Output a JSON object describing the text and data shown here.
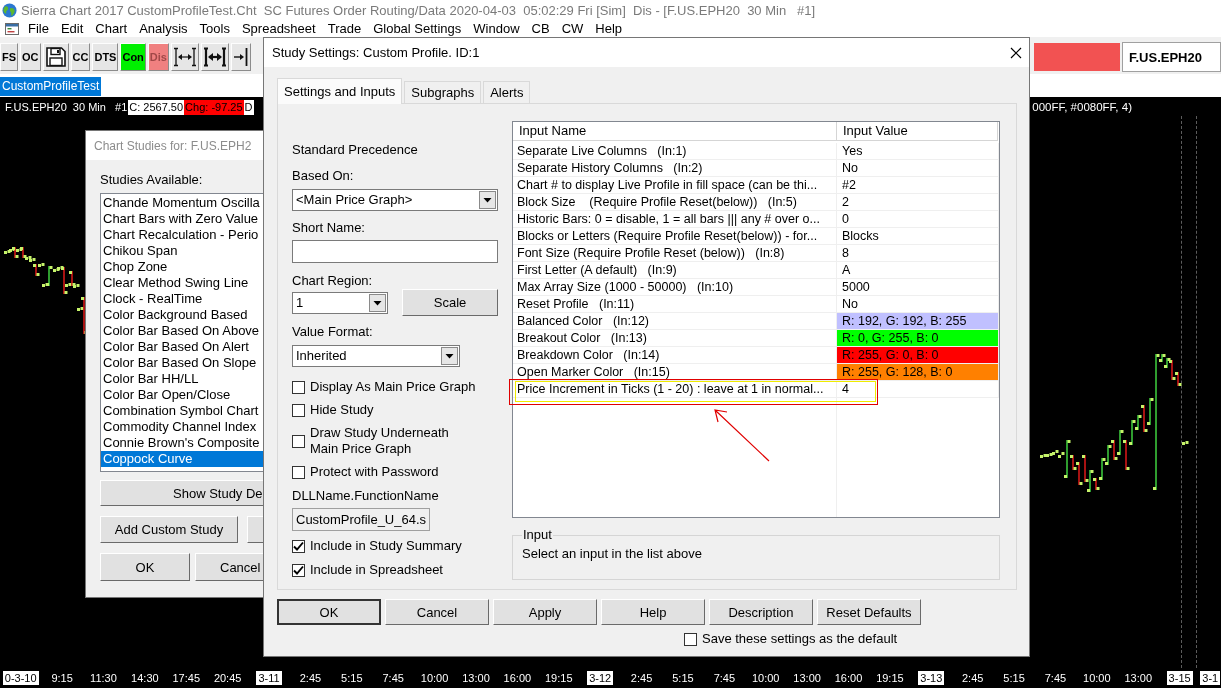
{
  "window": {
    "title": "Sierra Chart 2017 CustomProfileTest.Cht  SC Futures Order Routing/Data 2020-04-03  05:02:29 Fri [Sim]  Dis - [F.US.EPH20  30 Min   #1]"
  },
  "menu": [
    "File",
    "Edit",
    "Chart",
    "Analysis",
    "Tools",
    "Spreadsheet",
    "Trade",
    "Global Settings",
    "Window",
    "CB",
    "CW",
    "Help"
  ],
  "toolbar": {
    "buttons": [
      {
        "kind": "text",
        "label": "FS",
        "disabled": false
      },
      {
        "kind": "text",
        "label": "OC",
        "disabled": false
      },
      {
        "kind": "icon",
        "disabled": false
      },
      {
        "kind": "text",
        "label": "CC",
        "disabled": false
      },
      {
        "kind": "text",
        "label": "DTS",
        "disabled": false
      },
      {
        "kind": "text",
        "label": "Con",
        "disabled": false,
        "color": "#00f000"
      },
      {
        "kind": "text",
        "label": "Dis",
        "disabled": true,
        "color": "#f08080"
      },
      {
        "kind": "icon",
        "disabled": false
      },
      {
        "kind": "icon",
        "disabled": false
      },
      {
        "kind": "icon",
        "disabled": false
      }
    ],
    "symbol": "F.US.EPH20"
  },
  "chart_tabs": [
    {
      "label": "CustomProfileTest",
      "selected": true
    }
  ],
  "chart": {
    "info": [
      {
        "text": "F.US.EPH20  30 Min   #1",
        "color": "#000000"
      },
      {
        "text": "C: 2567.50",
        "color": "#ffffff"
      },
      {
        "text": "Chg: -97.25",
        "color": "#ff0000"
      },
      {
        "text": "D",
        "color": "#ffffff"
      }
    ],
    "info_right": "000FF, #0080FF, 4)",
    "time_axis": [
      {
        "kind": "date",
        "label": "0-3-10"
      },
      {
        "kind": "time",
        "label": "9:15"
      },
      {
        "kind": "time",
        "label": "11:30"
      },
      {
        "kind": "time",
        "label": "14:30"
      },
      {
        "kind": "time",
        "label": "17:45"
      },
      {
        "kind": "time",
        "label": "20:45"
      },
      {
        "kind": "date",
        "label": "3-11"
      },
      {
        "kind": "time",
        "label": "2:45"
      },
      {
        "kind": "time",
        "label": "5:15"
      },
      {
        "kind": "time",
        "label": "7:45"
      },
      {
        "kind": "time",
        "label": "10:00"
      },
      {
        "kind": "time",
        "label": "13:00"
      },
      {
        "kind": "time",
        "label": "16:00"
      },
      {
        "kind": "time",
        "label": "19:15"
      },
      {
        "kind": "date",
        "label": "3-12"
      },
      {
        "kind": "time",
        "label": "2:45"
      },
      {
        "kind": "time",
        "label": "5:15"
      },
      {
        "kind": "time",
        "label": "7:45"
      },
      {
        "kind": "time",
        "label": "10:00"
      },
      {
        "kind": "time",
        "label": "13:00"
      },
      {
        "kind": "time",
        "label": "16:00"
      },
      {
        "kind": "time",
        "label": "19:15"
      },
      {
        "kind": "date",
        "label": "3-13"
      },
      {
        "kind": "time",
        "label": "2:45"
      },
      {
        "kind": "time",
        "label": "5:15"
      },
      {
        "kind": "time",
        "label": "7:45"
      },
      {
        "kind": "time",
        "label": "10:00"
      },
      {
        "kind": "time",
        "label": "13:00"
      },
      {
        "kind": "date",
        "label": "3-15"
      },
      {
        "kind": "date",
        "label": "3-1"
      }
    ]
  },
  "studies_dialog": {
    "title": "Chart Studies for: F.US.EPH2",
    "list_label": "Studies Available:",
    "studies": [
      {
        "label": "Chande Momentum Oscilla",
        "selected": false
      },
      {
        "label": "Chart Bars with Zero Value",
        "selected": false
      },
      {
        "label": "Chart Recalculation - Perio",
        "selected": false
      },
      {
        "label": "Chikou Span",
        "selected": false
      },
      {
        "label": "Chop Zone",
        "selected": false
      },
      {
        "label": "Clear Method Swing Line",
        "selected": false
      },
      {
        "label": "Clock - RealTime",
        "selected": false
      },
      {
        "label": "Color Background Based",
        "selected": false
      },
      {
        "label": "Color Bar Based On Above",
        "selected": false
      },
      {
        "label": "Color Bar Based On Alert",
        "selected": false
      },
      {
        "label": "Color Bar Based On Slope",
        "selected": false
      },
      {
        "label": "Color Bar HH/LL",
        "selected": false
      },
      {
        "label": "Color Bar Open/Close",
        "selected": false
      },
      {
        "label": "Combination Symbol Chart",
        "selected": false
      },
      {
        "label": "Commodity Channel Index",
        "selected": false
      },
      {
        "label": "Connie Brown's Composite",
        "selected": false
      },
      {
        "label": "Coppock Curve",
        "selected": true
      }
    ],
    "show_button": "Show Study De",
    "add_button": "Add Custom Study",
    "ok_button": "OK",
    "cancel_button": "Cancel"
  },
  "settings_dialog": {
    "title": "Study Settings: Custom Profile. ID:1",
    "tabs": [
      {
        "label": "Settings and Inputs",
        "selected": true
      },
      {
        "label": "Subgraphs",
        "selected": false
      },
      {
        "label": "Alerts",
        "selected": false
      }
    ],
    "precedence": "Standard Precedence",
    "based_on": {
      "label": "Based On:",
      "value": "<Main Price Graph>"
    },
    "short_name": {
      "label": "Short Name:"
    },
    "chart_region": {
      "label": "Chart Region:",
      "value": "1"
    },
    "scale_button": "Scale",
    "value_format": {
      "label": "Value Format:",
      "value": "Inherited"
    },
    "options": [
      {
        "label": "Display As Main Price Graph",
        "checked": false
      },
      {
        "label": "Hide Study",
        "checked": false
      },
      {
        "label": "Draw Study Underneath Main Price Graph",
        "checked": false
      },
      {
        "label": "Protect with Password",
        "checked": false
      }
    ],
    "dll": {
      "label": "DLLName.FunctionName",
      "value": "CustomProfile_U_64.s"
    },
    "include_options": [
      {
        "label": "Include in Study Summary",
        "checked": true
      },
      {
        "label": "Include in Spreadsheet",
        "checked": true
      }
    ],
    "inputs": {
      "columns": [
        "Input Name",
        "Input Value"
      ],
      "rows": [
        {
          "name": "Separate Live Columns   (In:1)",
          "value": "Yes",
          "annotated": false
        },
        {
          "name": "Separate History Columns   (In:2)",
          "value": "No",
          "annotated": false
        },
        {
          "name": "Chart # to display Live Profile in fill space (can be thi...",
          "value": "#2",
          "annotated": false
        },
        {
          "name": "Block Size    (Require Profile Reset(below))   (In:5)",
          "value": "2",
          "annotated": false
        },
        {
          "name": "Historic Bars: 0 = disable, 1 = all bars ||| any # over o...",
          "value": "0",
          "annotated": false
        },
        {
          "name": "Blocks or Letters (Require Profile Reset(below)) - for...",
          "value": "Blocks",
          "annotated": false
        },
        {
          "name": "Font Size (Require Profile Reset (below))   (In:8)",
          "value": "8",
          "annotated": false
        },
        {
          "name": "First Letter (A default)   (In:9)",
          "value": "A",
          "annotated": false
        },
        {
          "name": "Max Array Size (1000 - 50000)   (In:10)",
          "value": "5000",
          "annotated": false
        },
        {
          "name": "Reset Profile   (In:11)",
          "value": "No",
          "annotated": false
        },
        {
          "name": "Balanced Color   (In:12)",
          "value": "R: 192, G: 192, B: 255",
          "color": "#c0c0ff",
          "annotated": false
        },
        {
          "name": "Breakout Color   (In:13)",
          "value": "R: 0, G: 255, B: 0",
          "color": "#00ff00",
          "annotated": false
        },
        {
          "name": "Breakdown Color   (In:14)",
          "value": "R: 255, G: 0, B: 0",
          "color": "#ff0000",
          "annotated": false
        },
        {
          "name": "Open Marker Color   (In:15)",
          "value": "R: 255, G: 128, B: 0",
          "color": "#ff8000",
          "annotated": false
        },
        {
          "name": "Price Increment in Ticks (1 - 20) : leave at 1 in normal...",
          "value": "4",
          "annotated": true
        }
      ]
    },
    "input_group": {
      "title": "Input",
      "text": "Select an input in the list above"
    },
    "buttons": [
      {
        "label": "OK",
        "default": true
      },
      {
        "label": "Cancel",
        "default": false
      },
      {
        "label": "Apply",
        "default": false
      },
      {
        "label": "Help",
        "default": false
      },
      {
        "label": "Description",
        "default": false
      },
      {
        "label": "Reset Defaults",
        "default": false
      }
    ],
    "save_default": {
      "label": "Save these settings as the default",
      "checked": false
    }
  }
}
